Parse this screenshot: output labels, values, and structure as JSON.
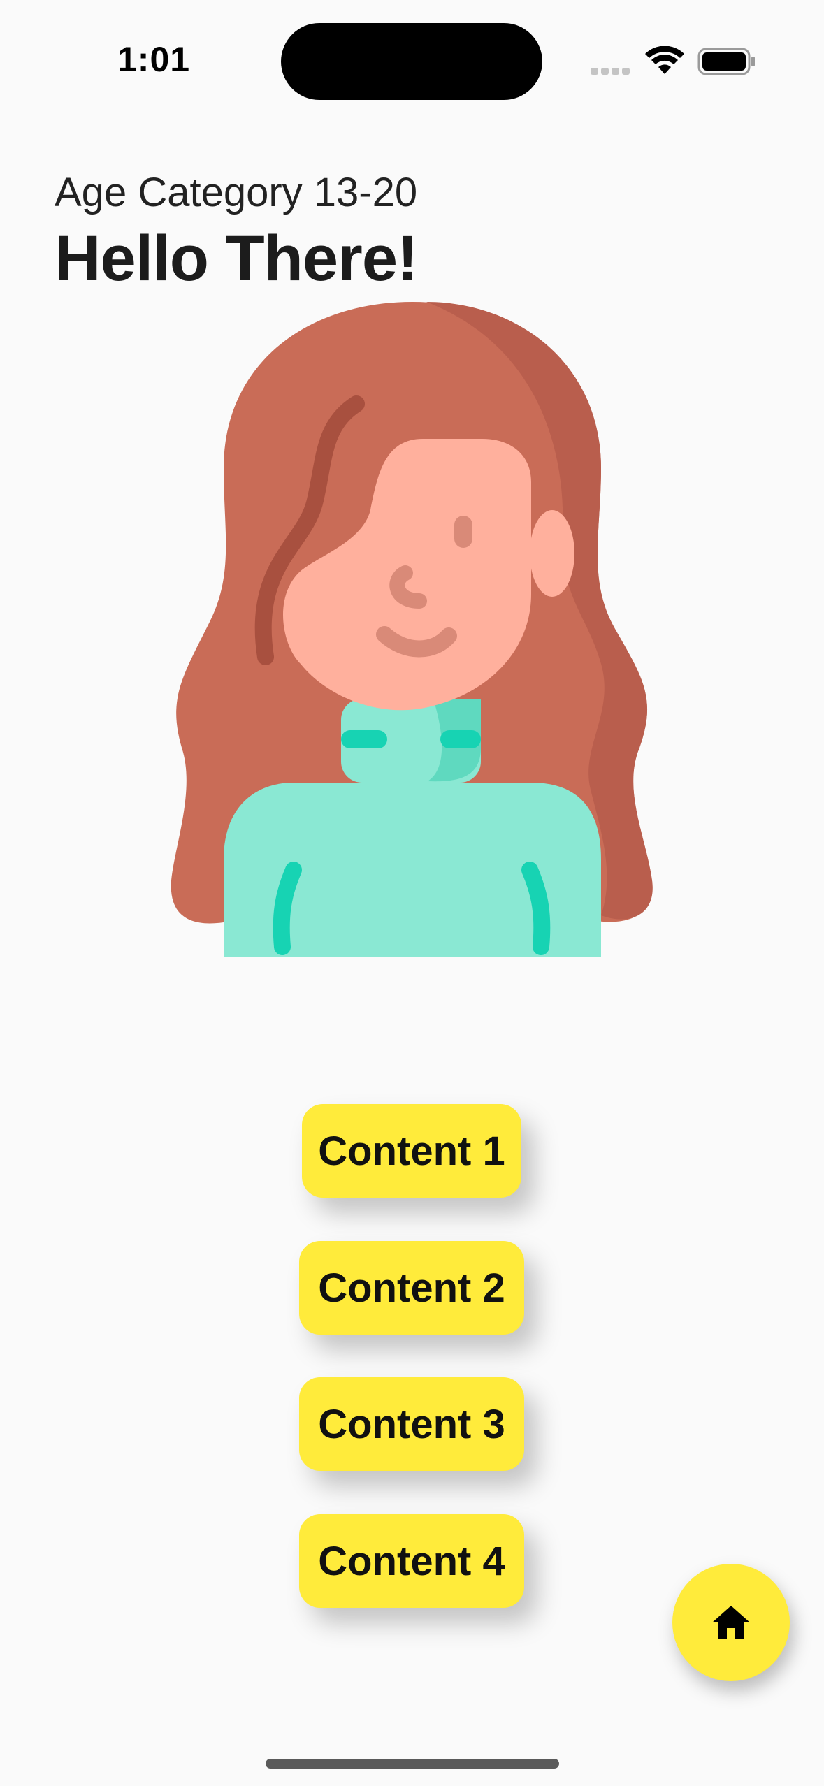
{
  "status_bar": {
    "time": "1:01"
  },
  "header": {
    "subtitle": "Age Category 13-20",
    "title": "Hello There!"
  },
  "avatar": {
    "description_icon": "girl-avatar-illustration",
    "colors": {
      "hair": "#c96c57",
      "hair_shadow": "#b95e4d",
      "hair_strand": "#a8503f",
      "skin": "#ffb09d",
      "skin_detail": "#d98a78",
      "sweater": "#8ae8d3",
      "sweater_shadow": "#5fd9bf",
      "sweater_accent": "#17d3b3"
    }
  },
  "content_buttons": [
    {
      "label": "Content 1"
    },
    {
      "label": "Content 2"
    },
    {
      "label": "Content 3"
    },
    {
      "label": "Content 4"
    }
  ],
  "fab": {
    "icon": "home-icon"
  },
  "colors": {
    "background": "#fafafa",
    "accent_yellow": "#ffeb3b",
    "text": "#1f1f1f"
  }
}
